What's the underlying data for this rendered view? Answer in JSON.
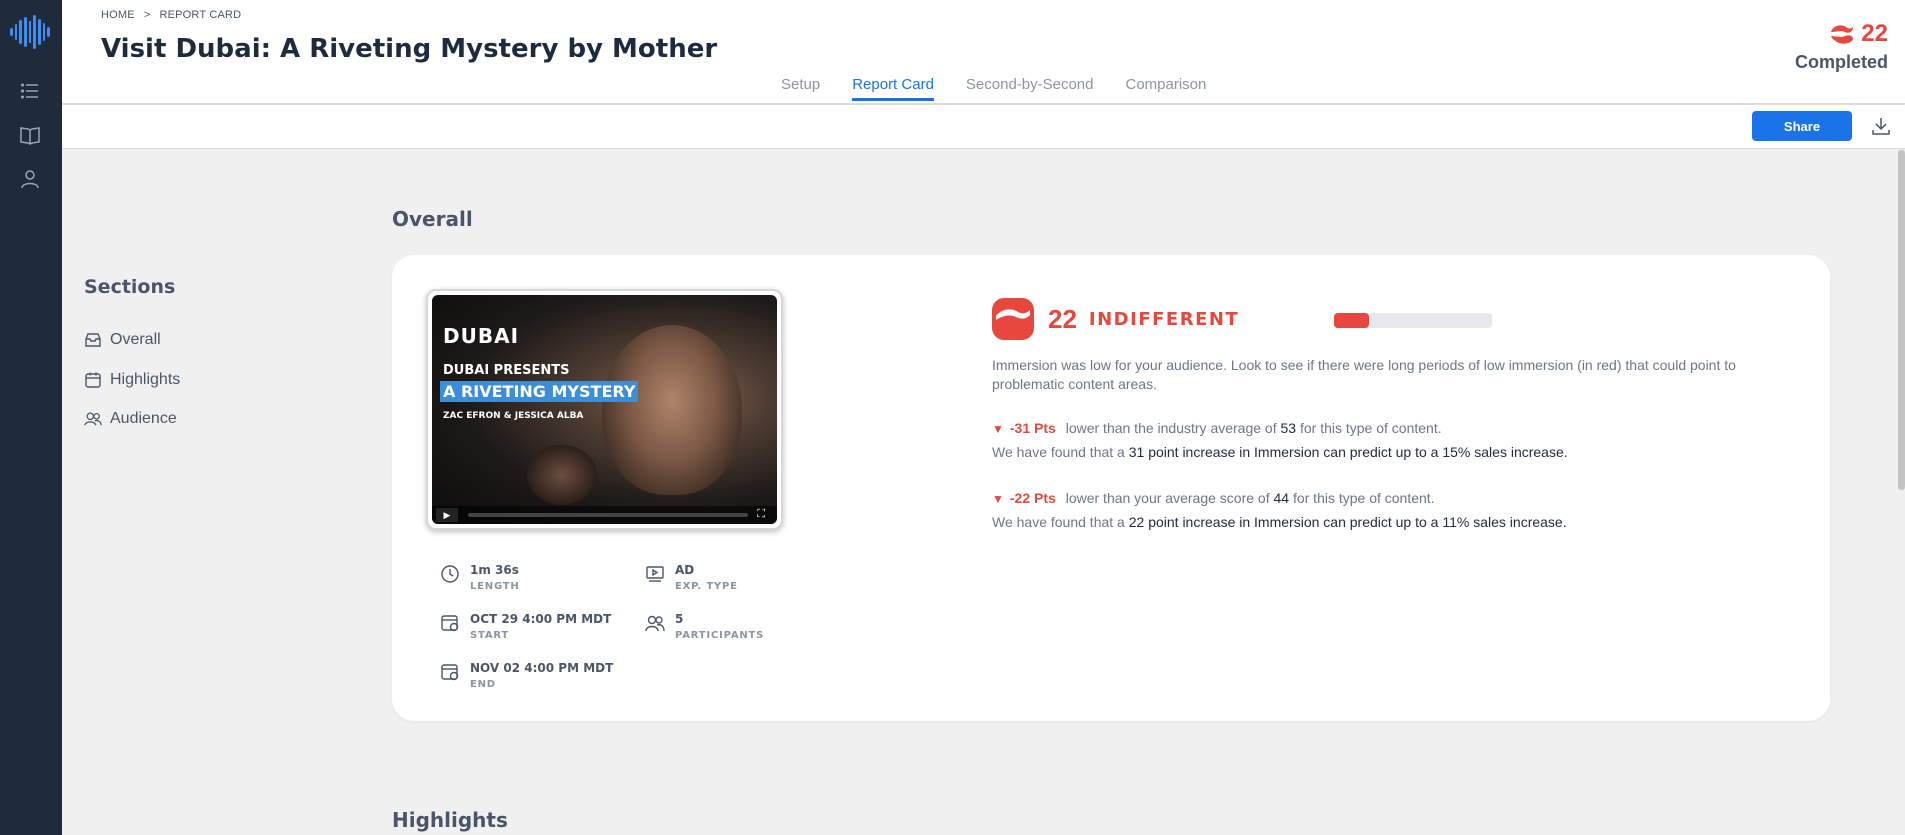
{
  "rail": {
    "icons": [
      "logo-waveform-icon",
      "list-icon",
      "book-icon",
      "user-icon"
    ]
  },
  "breadcrumb": {
    "home": "HOME",
    "separator": ">",
    "current": "REPORT CARD"
  },
  "title": "Visit Dubai: A Riveting Mystery by Mother",
  "tabs": [
    {
      "label": "Setup",
      "active": false
    },
    {
      "label": "Report Card",
      "active": true
    },
    {
      "label": "Second-by-Second",
      "active": false
    },
    {
      "label": "Comparison",
      "active": false
    }
  ],
  "top_score": {
    "value": "22",
    "status": "Completed"
  },
  "toolbar": {
    "share_label": "Share"
  },
  "sections": {
    "title": "Sections",
    "items": [
      {
        "label": "Overall",
        "icon": "inbox-icon"
      },
      {
        "label": "Highlights",
        "icon": "calendar-icon"
      },
      {
        "label": "Audience",
        "icon": "users-icon"
      }
    ]
  },
  "overall": {
    "heading": "Overall",
    "video": {
      "brand": "DUBAI",
      "presents": "DUBAI PRESENTS",
      "headline": "A RIVETING MYSTERY",
      "cast": "ZAC EFRON & JESSICA ALBA",
      "play": "▶",
      "fullscreen": "⛶"
    },
    "meta": {
      "length": {
        "value": "1m 36s",
        "label": "LENGTH"
      },
      "exp_type": {
        "value": "AD",
        "label": "EXP. TYPE"
      },
      "start": {
        "value": "OCT 29 4:00 PM MDT",
        "label": "START"
      },
      "participants": {
        "value": "5",
        "label": "PARTICIPANTS"
      },
      "end": {
        "value": "NOV 02 4:00 PM MDT",
        "label": "END"
      }
    },
    "immersion": {
      "score": "22",
      "rating": "INDIFFERENT",
      "bar_fraction": 0.22,
      "description": "Immersion was low for your audience. Look to see if there were long periods of low immersion (in red) that could point to problematic content areas."
    },
    "comparisons": [
      {
        "pts": "-31 Pts",
        "text_before": "lower than the industry average of",
        "value": "53",
        "text_after": "for this type of content.",
        "sub_before": "We have found that a",
        "sub_value": "31",
        "sub_after": "point increase in Immersion can predict up to a 15% sales increase."
      },
      {
        "pts": "-22 Pts",
        "text_before": "lower than your average score of",
        "value": "44",
        "text_after": "for this type of content.",
        "sub_before": "We have found that a",
        "sub_value": "22",
        "sub_after": "point increase in Immersion can predict up to a 11% sales increase."
      }
    ]
  },
  "highlights": {
    "heading": "Highlights"
  },
  "colors": {
    "accent": "#1a73e8",
    "immersion_red": "#e8473e",
    "rail": "#1f2b3d"
  }
}
